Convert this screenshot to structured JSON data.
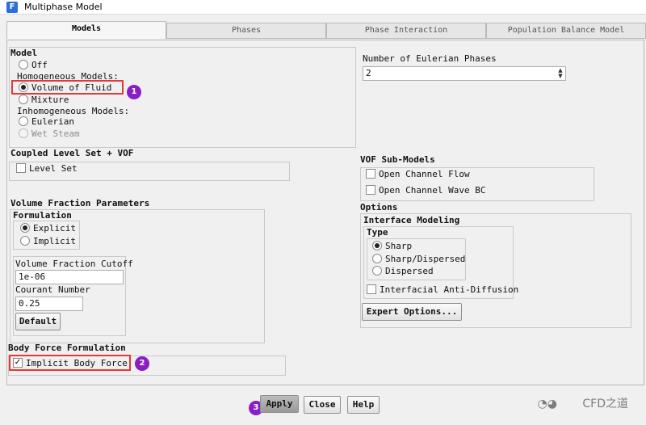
{
  "window": {
    "title": "Multiphase Model",
    "icon": "F"
  },
  "tabs": [
    "Models",
    "Phases",
    "Phase Interaction",
    "Population Balance Model"
  ],
  "model": {
    "title": "Model",
    "off": "Off",
    "homogeneous_header": "Homogeneous Models:",
    "vof": "Volume of Fluid",
    "mixture": "Mixture",
    "inhomogeneous_header": "Inhomogeneous Models:",
    "eulerian": "Eulerian",
    "wet_steam": "Wet Steam",
    "selected": "Volume of Fluid"
  },
  "eulerian_phases": {
    "label": "Number of Eulerian Phases",
    "value": "2"
  },
  "coupled": {
    "title": "Coupled Level Set + VOF",
    "level_set": "Level Set"
  },
  "vof_sub": {
    "title": "VOF Sub-Models",
    "open_channel_flow": "Open Channel Flow",
    "open_channel_wave": "Open Channel Wave BC"
  },
  "vfp": {
    "title": "Volume Fraction Parameters",
    "formulation_title": "Formulation",
    "explicit": "Explicit",
    "implicit": "Implicit",
    "cutoff_label": "Volume Fraction Cutoff",
    "cutoff_value": "1e-06",
    "courant_label": "Courant Number",
    "courant_value": "0.25",
    "default_button": "Default"
  },
  "options": {
    "title": "Options",
    "interface_title": "Interface Modeling",
    "type_title": "Type",
    "sharp": "Sharp",
    "sharp_dispersed": "Sharp/Dispersed",
    "dispersed": "Dispersed",
    "anti_diffusion": "Interfacial Anti-Diffusion",
    "expert_button": "Expert Options..."
  },
  "body_force": {
    "title": "Body Force Formulation",
    "implicit": "Implicit Body Force",
    "checked": true
  },
  "buttons": {
    "apply": "Apply",
    "close": "Close",
    "help": "Help"
  },
  "markers": [
    "1",
    "2",
    "3"
  ],
  "watermark": "CFD之道",
  "colors": {
    "highlight": "#e53935",
    "marker": "#8a1ec6",
    "title_icon": "#2d6fd6"
  }
}
